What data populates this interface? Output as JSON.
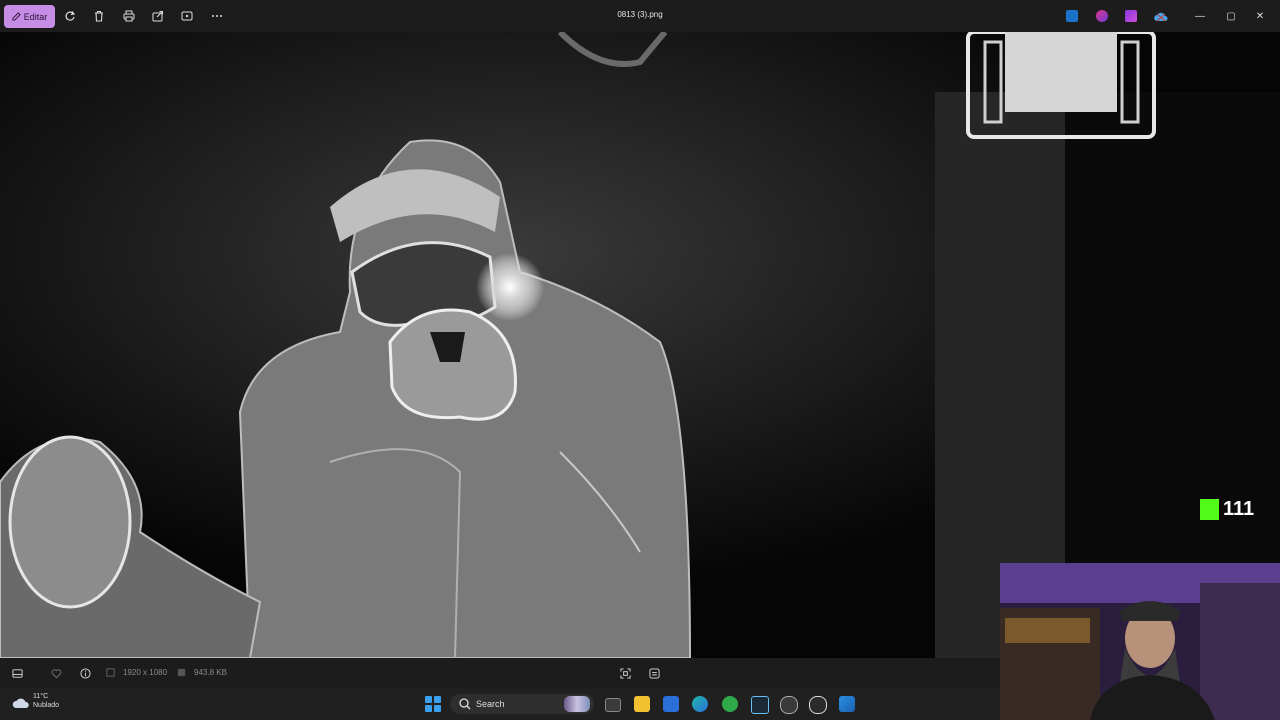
{
  "titlebar": {
    "edit_label": "Editar",
    "file_name": "0813 (3).png",
    "tools": [
      "rotate-icon",
      "delete-icon",
      "print-icon",
      "share-icon",
      "slideshow-icon",
      "more-icon"
    ],
    "tray_apps": [
      "photoshop-icon",
      "clipchamp-icon",
      "designer-icon",
      "onedrive-icon"
    ],
    "window_controls": {
      "minimize": "—",
      "maximize": "▢",
      "close": "✕"
    }
  },
  "status": {
    "dimensions": "1920 x 1080",
    "file_size": "943.8 KB"
  },
  "taskbar": {
    "weather_temp": "11°C",
    "weather_desc": "Nublado",
    "search_label": "Search",
    "apps": [
      "task-view-icon",
      "file-explorer-icon",
      "store-icon",
      "edge-icon",
      "xbox-icon",
      "steam-icon",
      "settings-icon",
      "media-player-icon",
      "photos-icon"
    ]
  },
  "overlay": {
    "kick_count": "111"
  },
  "colors": {
    "accent_edit": "#c68de6",
    "kick_green": "#53fc18",
    "titlebar_bg": "#1c1c1c",
    "taskbar_bg": "#202020"
  }
}
